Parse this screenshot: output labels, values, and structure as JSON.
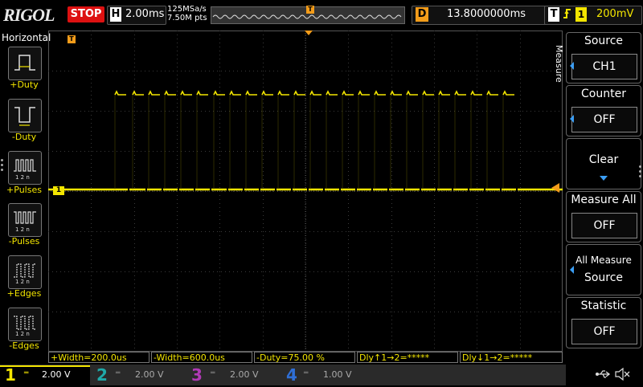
{
  "topbar": {
    "logo": "RIGOL",
    "run_state": "STOP",
    "horizontal_label": "H",
    "timebase": "2.00ms",
    "sample_rate": "125MSa/s",
    "memory_depth": "7.50M pts",
    "trigger_position_marker": "T",
    "delay_label": "D",
    "delay_value": "13.8000000ms",
    "trigger_label": "T",
    "trigger_edge": "rising-edge-icon",
    "trigger_channel": "1",
    "trigger_level": "200mV"
  },
  "left_panel": {
    "title": "Horizontal",
    "items": [
      {
        "label": "+Duty",
        "icon": "positive-duty-icon"
      },
      {
        "label": "-Duty",
        "icon": "negative-duty-icon"
      },
      {
        "label": "+Pulses",
        "icon": "positive-pulses-icon"
      },
      {
        "label": "-Pulses",
        "icon": "negative-pulses-icon"
      },
      {
        "label": "+Edges",
        "icon": "rising-edges-icon"
      },
      {
        "label": "-Edges",
        "icon": "falling-edges-icon"
      }
    ]
  },
  "waveform": {
    "channel_marker": "1",
    "trigger_marker": "T",
    "colors": {
      "ch1": "#f3e500",
      "grid": "#3a3a3a",
      "trigger": "#f39c1a"
    }
  },
  "right_panel": {
    "tab_label": "Measure",
    "source": {
      "title": "Source",
      "value": "CH1"
    },
    "counter": {
      "title": "Counter",
      "value": "OFF"
    },
    "clear": {
      "title": "Clear"
    },
    "measure_all": {
      "title": "Measure All",
      "value": "OFF"
    },
    "all_measure_source": {
      "line1": "All Measure",
      "line2": "Source"
    },
    "statistic": {
      "title": "Statistic",
      "value": "OFF"
    }
  },
  "measurements": [
    "+Width=200.0us",
    "-Width=600.0us",
    "-Duty=75.00 %",
    "Dly↑1→2=*****",
    "Dly↓1→2=*****"
  ],
  "bottom": {
    "channels": [
      {
        "num": "1",
        "scale": "2.00 V",
        "color": "#f3e500"
      },
      {
        "num": "2",
        "scale": "2.00 V",
        "color": "#1fa9a9"
      },
      {
        "num": "3",
        "scale": "2.00 V",
        "color": "#b03ab5"
      },
      {
        "num": "4",
        "scale": "1.00 V",
        "color": "#2f6fd6"
      }
    ],
    "usb_icon": "usb-icon",
    "sound_icon": "speaker-muted-icon"
  }
}
